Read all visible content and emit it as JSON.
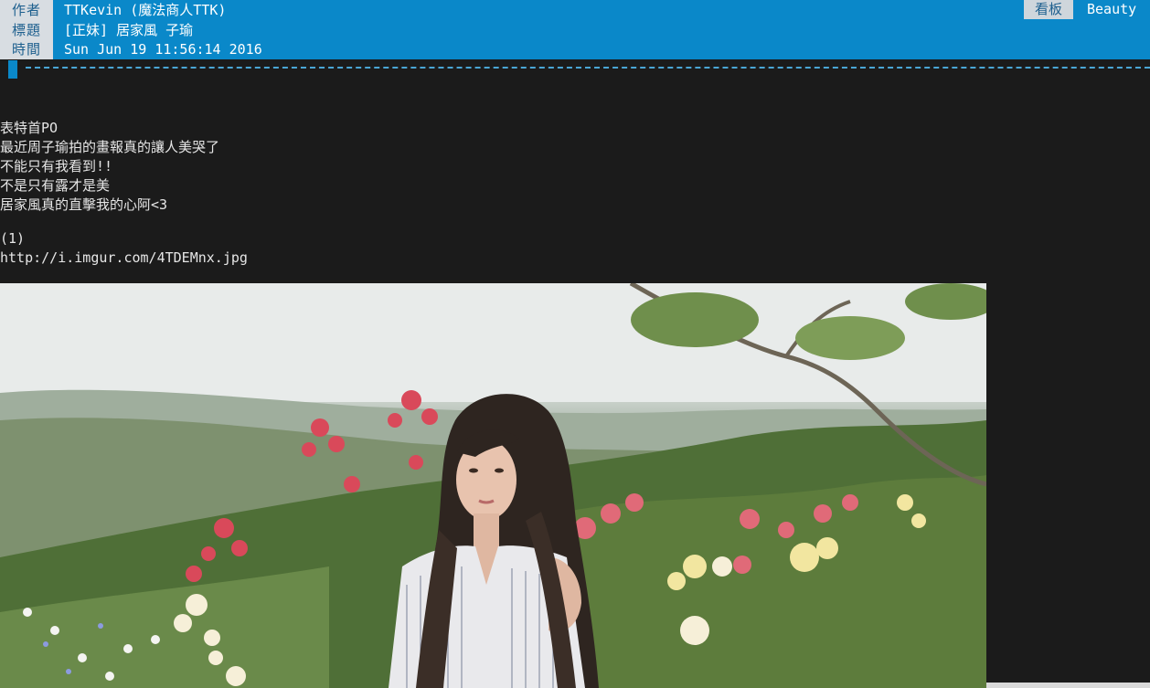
{
  "header": {
    "author_label": "作者",
    "author_value": "TTKevin (魔法商人TTK)",
    "title_label": "標題",
    "title_value": "[正妹] 居家風 子瑜",
    "time_label": "時間",
    "time_value": "Sun Jun 19 11:56:14 2016",
    "board_label": "看板",
    "board_value": "Beauty"
  },
  "body": {
    "lines": [
      "表特首PO",
      "最近周子瑜拍的畫報真的讓人美哭了",
      "不能只有我看到!!",
      "不是只有露才是美",
      "居家風真的直擊我的心阿<3"
    ],
    "image_index": "(1)",
    "image_url": "http://i.imgur.com/4TDEMnx.jpg"
  },
  "colors": {
    "header_bg": "#0a88c9",
    "label_bg": "#d8dde2",
    "terminal_bg": "#1b1b1b",
    "text": "#e6e6e6"
  }
}
